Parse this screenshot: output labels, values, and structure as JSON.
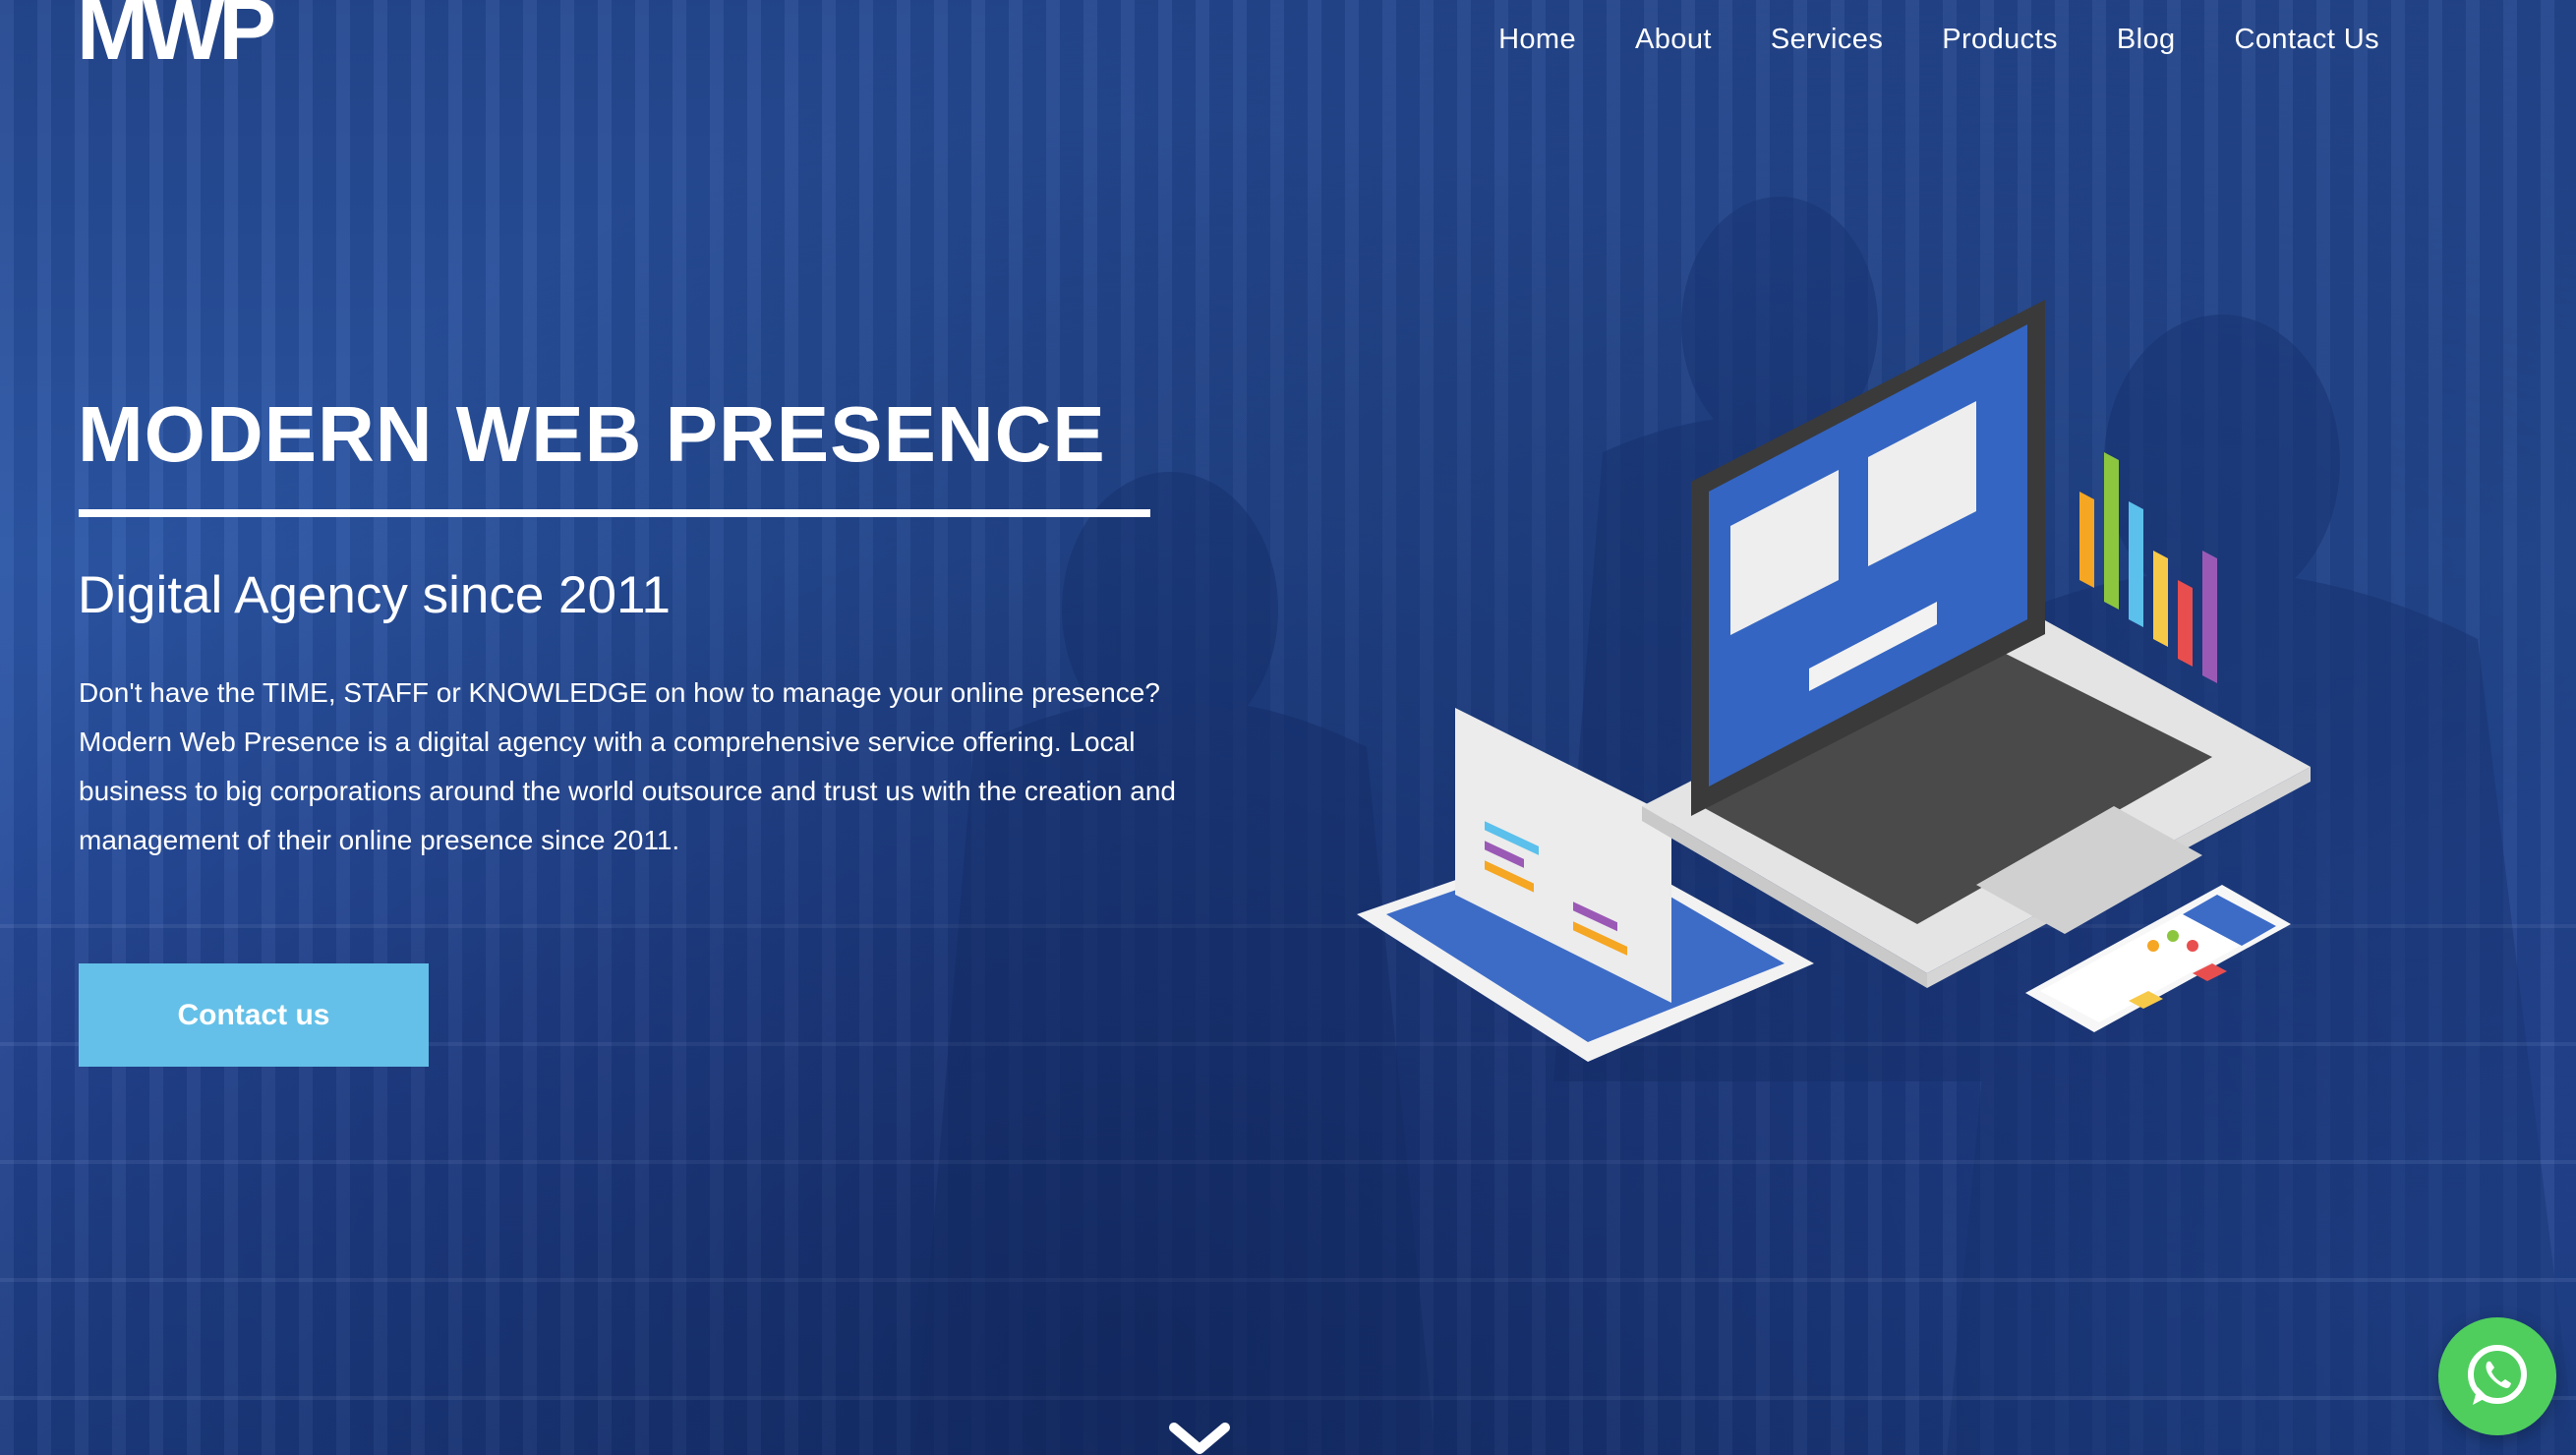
{
  "header": {
    "logo_text": "MWP",
    "nav": [
      {
        "label": "Home"
      },
      {
        "label": "About"
      },
      {
        "label": "Services"
      },
      {
        "label": "Products"
      },
      {
        "label": "Blog"
      },
      {
        "label": "Contact Us"
      }
    ]
  },
  "hero": {
    "title": "MODERN WEB PRESENCE",
    "subtitle": "Digital Agency since 2011",
    "description": "Don't have the TIME, STAFF or KNOWLEDGE on how to manage your online presence? Modern Web Presence is a digital agency with a comprehensive service offering. Local business to big corporations around the world outsource and trust us with the creation and management of their online presence since 2011.",
    "cta_label": "Contact us"
  },
  "icons": {
    "scroll": "chevron-down-icon",
    "chat": "whatsapp-icon"
  },
  "colors": {
    "overlay": "#2b56a6",
    "cta": "#64c0e8",
    "whatsapp": "#4fce5d",
    "text": "#ffffff"
  }
}
